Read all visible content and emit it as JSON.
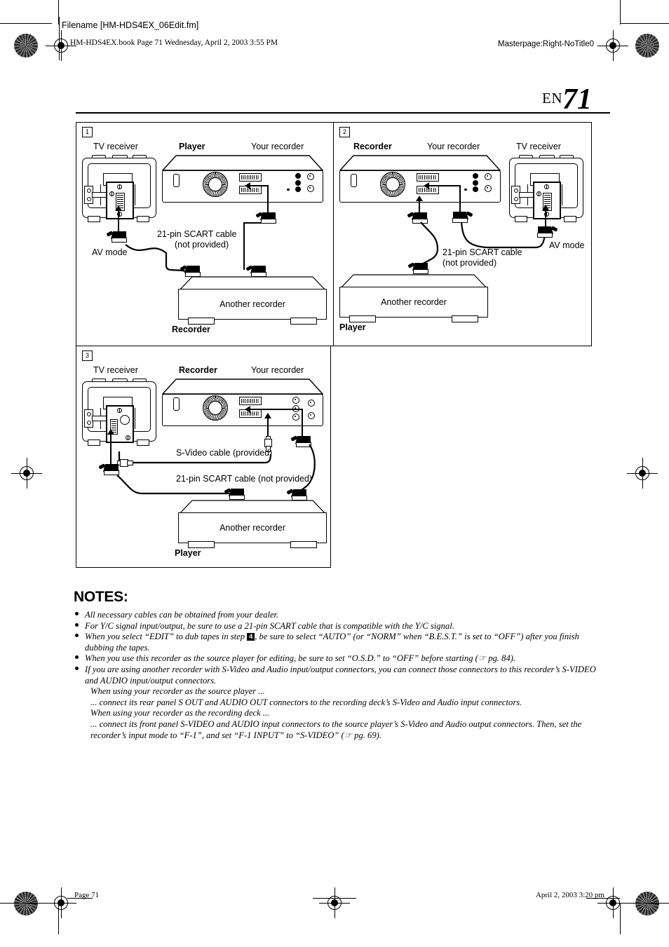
{
  "header": {
    "filename": "Filename [HM-HDS4EX_06Edit.fm]",
    "book_line": "HM-HDS4EX.book  Page 71  Wednesday, April 2, 2003  3:55 PM",
    "masterpage": "Masterpage:Right-NoTitle0"
  },
  "page_number": {
    "lang": "EN",
    "number": "71"
  },
  "figure": {
    "panels": [
      {
        "number": "1",
        "labels": {
          "tv": "TV receiver",
          "role_left": "Player",
          "your_recorder": "Your recorder",
          "av_mode": "AV mode",
          "cable_line1": "21-pin SCART cable",
          "cable_line2": "(not provided)",
          "another_recorder": "Another recorder",
          "role_bottom": "Recorder"
        }
      },
      {
        "number": "2",
        "labels": {
          "role_left": "Recorder",
          "your_recorder": "Your recorder",
          "tv": "TV receiver",
          "av_mode": "AV mode",
          "cable_line1": "21-pin SCART cable",
          "cable_line2": "(not provided)",
          "another_recorder": "Another recorder",
          "role_bottom": "Player"
        }
      },
      {
        "number": "3",
        "labels": {
          "tv": "TV receiver",
          "role_left": "Recorder",
          "your_recorder": "Your recorder",
          "svideo_cable": "S-Video cable (provided)",
          "scart_cable": "21-pin SCART cable  (not provided)",
          "another_recorder": "Another recorder",
          "role_bottom": "Player"
        }
      }
    ]
  },
  "notes": {
    "title": "NOTES:",
    "items": [
      {
        "text": "All necessary cables can be obtained from your dealer."
      },
      {
        "text": "For Y/C signal input/output, be sure to use a 21-pin SCART cable that is compatible with the Y/C signal."
      },
      {
        "prefix": "When you select “EDIT” to dub tapes in step ",
        "step": "4",
        "suffix": ", be sure to select “AUTO” (or “NORM” when “B.E.S.T.” is set to “OFF”) after you finish dubbing the tapes."
      },
      {
        "text": "When you use this recorder as the source player for editing, be sure to set “O.S.D.” to “OFF” before starting (☞ pg. 84)."
      },
      {
        "text": "If you are using another recorder with S-Video and Audio input/output connectors, you can connect those connectors to this recorder’s S-VIDEO and AUDIO input/output connectors.",
        "sub": [
          "When using your recorder as the source player ...",
          "... connect its rear panel S OUT and AUDIO OUT connectors to the recording deck’s S-Video and Audio input connectors.",
          "When using your recorder as the recording deck ...",
          "... connect its front panel S-VIDEO and AUDIO input connectors to the source player’s S-Video and Audio output connectors. Then, set the recorder’s input mode to “F-1”, and set “F-1 INPUT” to “S-VIDEO” (☞ pg. 69)."
        ]
      }
    ]
  },
  "footer": {
    "left": "Page 71",
    "right": "April 2, 2003 3:20 pm"
  }
}
